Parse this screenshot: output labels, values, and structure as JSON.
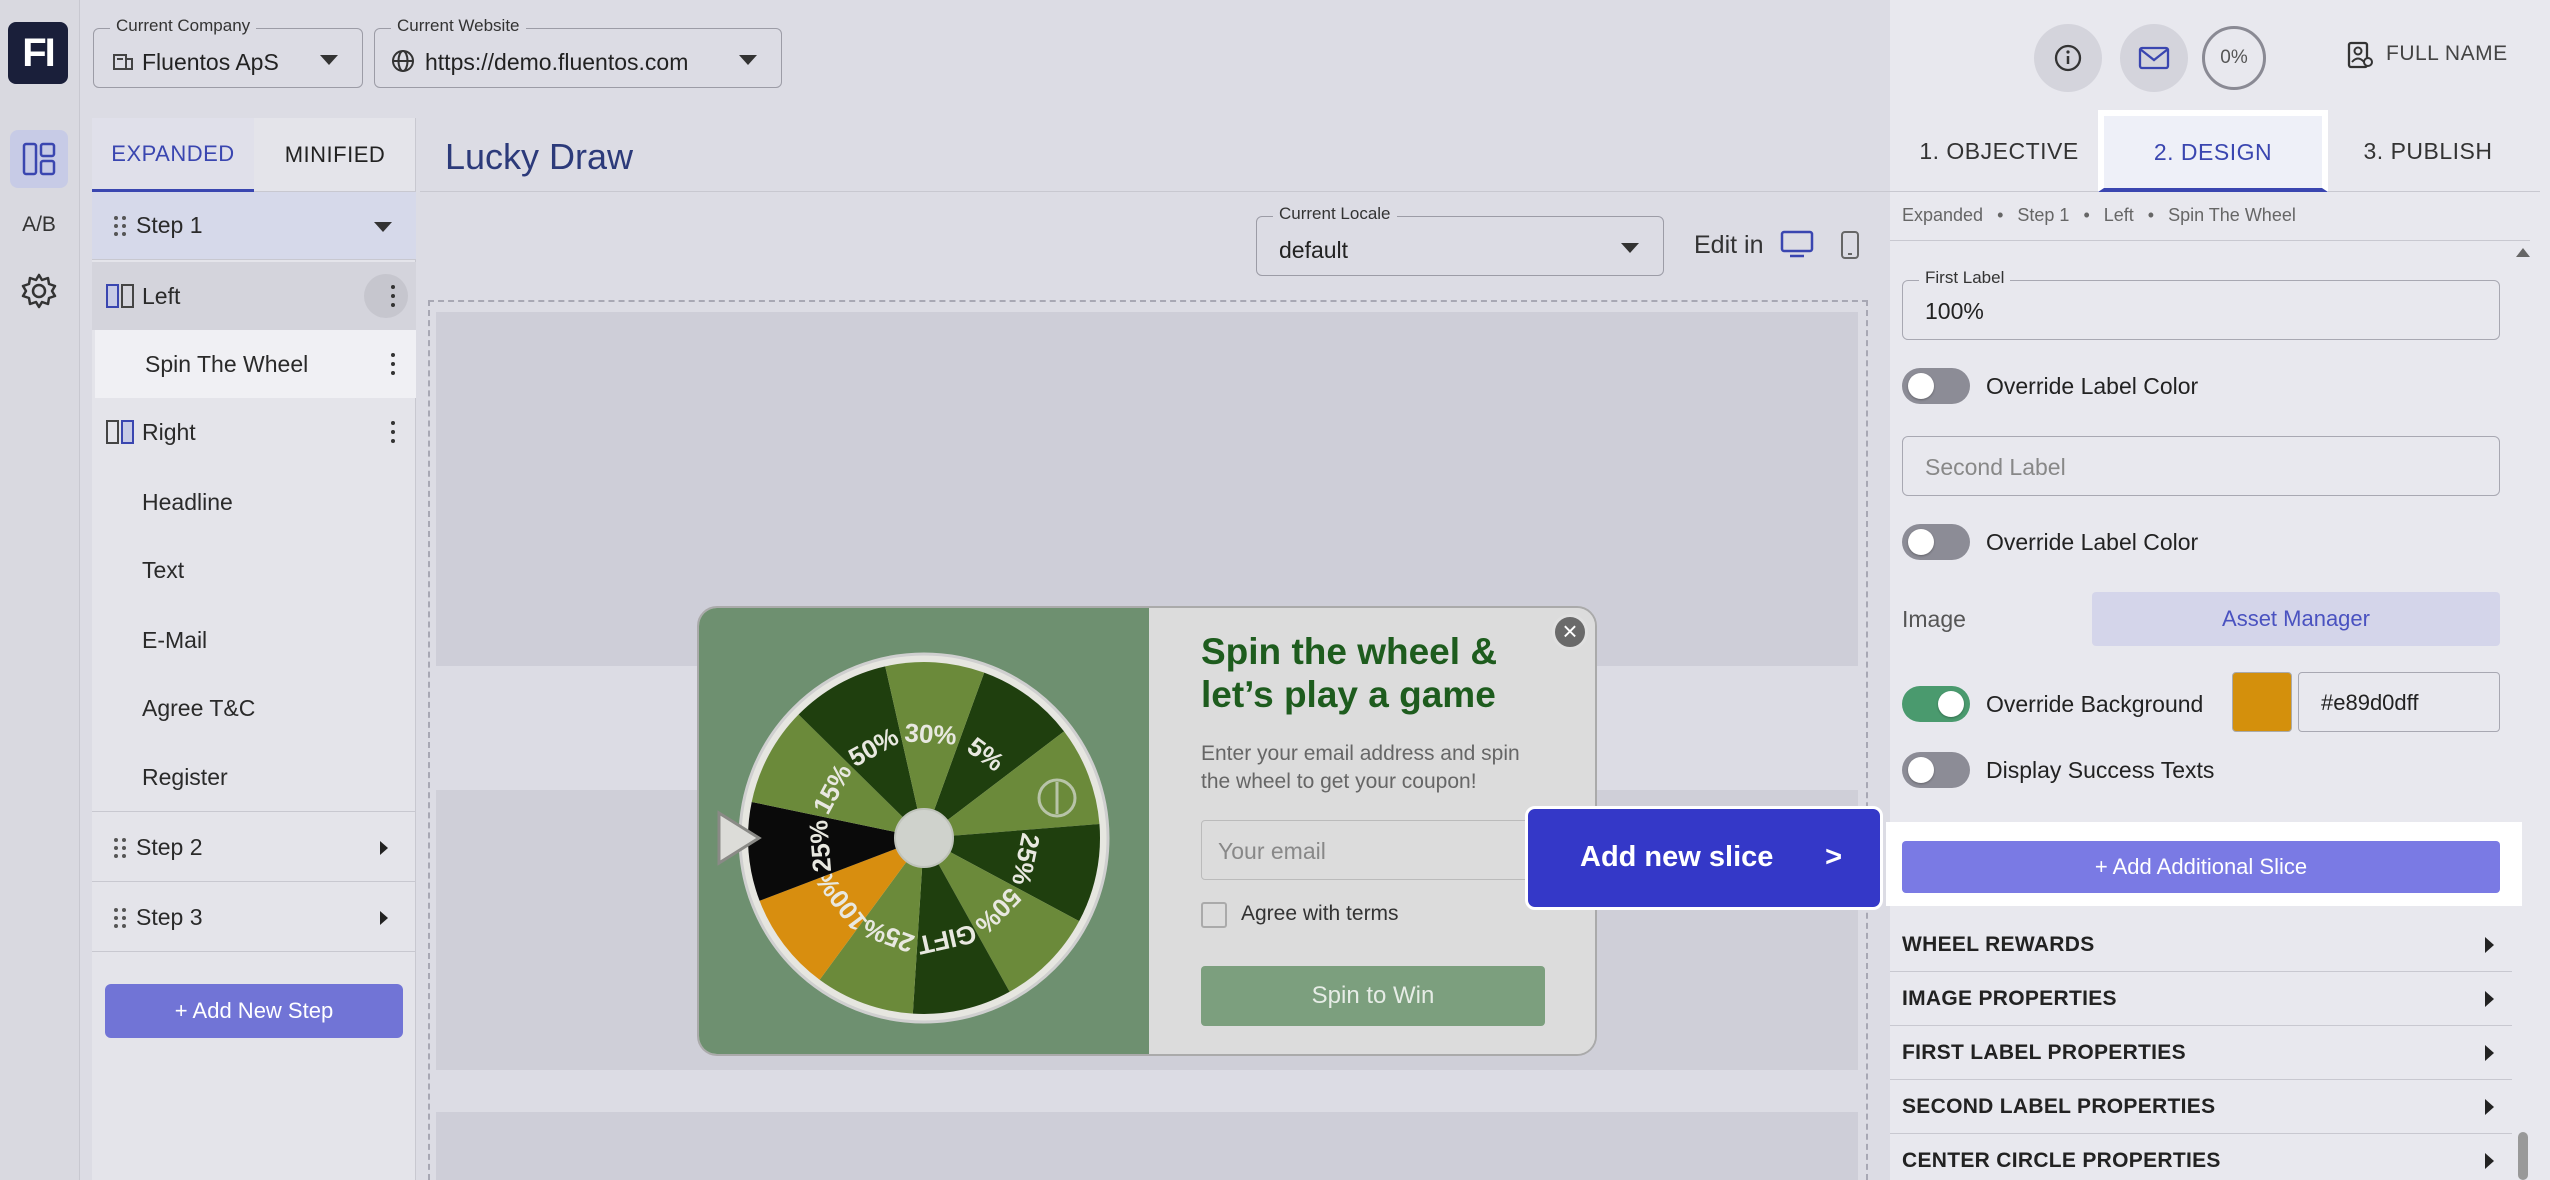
{
  "app": {
    "logo_text": "FI",
    "rail": {
      "ab_label": "A/B"
    }
  },
  "topbar": {
    "company_label": "Current Company",
    "company_value": "Fluentos ApS",
    "website_label": "Current Website",
    "website_value": "https://demo.fluentos.com",
    "progress": "0%",
    "user_name": "FULL NAME"
  },
  "steps_panel": {
    "tabs": [
      {
        "label": "EXPANDED"
      },
      {
        "label": "MINIFIED"
      }
    ],
    "items": [
      {
        "label": "Step 1"
      },
      {
        "label": "Left"
      },
      {
        "label": "Spin The Wheel"
      },
      {
        "label": "Right"
      },
      {
        "label": "Headline"
      },
      {
        "label": "Text"
      },
      {
        "label": "E-Mail"
      },
      {
        "label": "Agree T&C"
      },
      {
        "label": "Register"
      },
      {
        "label": "Step 2"
      },
      {
        "label": "Step 3"
      }
    ],
    "add_step_label": "+ Add New Step"
  },
  "editor": {
    "title": "Lucky Draw",
    "locale_label": "Current Locale",
    "locale_value": "default",
    "edit_in_label": "Edit in"
  },
  "popup": {
    "heading": "Spin the wheel & let’s play a game",
    "subtext": "Enter your email address and spin the wheel to get your coupon!",
    "email_placeholder": "Your email",
    "terms_label": "Agree with terms",
    "button_label": "Spin to Win",
    "close_label": "×",
    "wheel_slices": [
      "5%",
      "",
      "25%",
      "50%",
      "GIFT",
      "25%",
      "100%",
      "25%",
      "15%",
      "50%",
      "30%"
    ],
    "accent_color": "#1e5c1e"
  },
  "callout": {
    "label": "Add new slice",
    "arrow": ">"
  },
  "right_panel": {
    "tabs": [
      {
        "label": "1. OBJECTIVE"
      },
      {
        "label": "2. DESIGN"
      },
      {
        "label": "3. PUBLISH"
      }
    ],
    "breadcrumb": [
      "Expanded",
      "Step 1",
      "Left",
      "Spin The Wheel"
    ],
    "first_label_label": "First Label",
    "first_label_value": "100%",
    "override_label_color_1": "Override Label Color",
    "second_label_placeholder": "Second Label",
    "override_label_color_2": "Override Label Color",
    "image_label": "Image",
    "asset_manager_label": "Asset Manager",
    "override_background_label": "Override Background",
    "background_color_value": "#e89d0dff",
    "display_success_label": "Display Success Texts",
    "add_slice_label": "+ Add Additional Slice",
    "accordions": [
      {
        "label": "WHEEL REWARDS"
      },
      {
        "label": "IMAGE PROPERTIES"
      },
      {
        "label": "FIRST LABEL PROPERTIES"
      },
      {
        "label": "SECOND LABEL PROPERTIES"
      },
      {
        "label": "CENTER CIRCLE PROPERTIES"
      }
    ]
  }
}
